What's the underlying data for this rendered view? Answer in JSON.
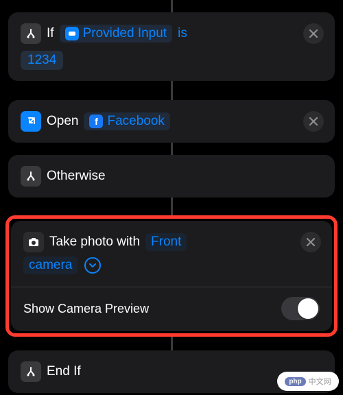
{
  "colors": {
    "accent": "#0a84ff",
    "highlight": "#ff3b30"
  },
  "block_if": {
    "keyword": "If",
    "input_token_label": "Provided Input",
    "condition": "is",
    "value": "1234"
  },
  "block_open": {
    "keyword": "Open",
    "app_name": "Facebook"
  },
  "block_otherwise": {
    "keyword": "Otherwise"
  },
  "block_photo": {
    "text_prefix": "Take photo with",
    "camera_param1": "Front",
    "camera_param2": "camera",
    "option_label": "Show Camera Preview",
    "option_value": false
  },
  "block_endif": {
    "keyword": "End If"
  },
  "watermark": {
    "badge": "php",
    "text": "中文网"
  }
}
